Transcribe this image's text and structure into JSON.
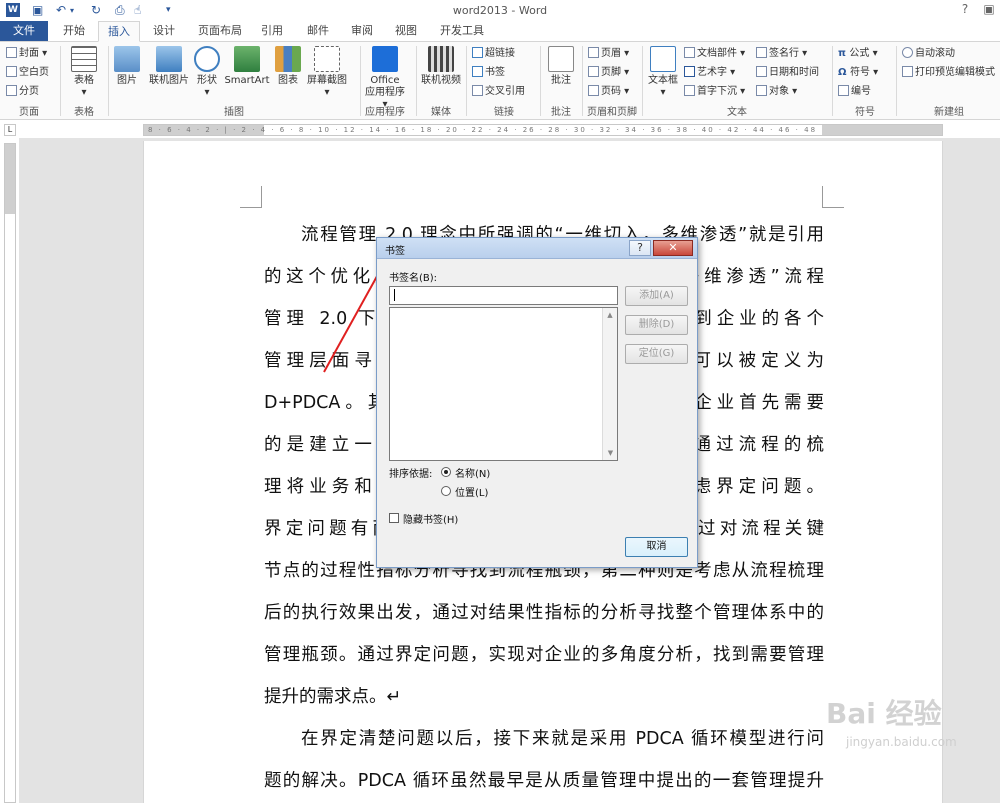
{
  "window": {
    "title": "word2013 - Word",
    "help": "?",
    "logo": "W"
  },
  "tabs": [
    "文件",
    "开始",
    "插入",
    "设计",
    "页面布局",
    "引用",
    "邮件",
    "审阅",
    "视图",
    "开发工具"
  ],
  "ribbon": {
    "page": {
      "cover": "封面",
      "blank": "空白页",
      "break": "分页",
      "group": "页面"
    },
    "table": {
      "label": "表格",
      "group": "表格"
    },
    "illus": {
      "picture": "图片",
      "online_picture": "联机图片",
      "shapes": "形状",
      "smartart": "SmartArt",
      "chart": "图表",
      "screenshot": "屏幕截图",
      "group": "插图"
    },
    "apps": {
      "label1": "Office",
      "label2": "应用程序",
      "group": "应用程序"
    },
    "media": {
      "label": "联机视频",
      "group": "媒体"
    },
    "links": {
      "hyperlink": "超链接",
      "bookmark": "书签",
      "xref": "交叉引用",
      "group": "链接"
    },
    "comments": {
      "label": "批注",
      "group": "批注"
    },
    "hf": {
      "header": "页眉",
      "footer": "页脚",
      "page_num": "页码",
      "group": "页眉和页脚"
    },
    "text": {
      "textbox": "文本框",
      "parts": "文档部件",
      "wordart": "艺术字",
      "dropcap": "首字下沉",
      "sigline": "签名行",
      "datetime": "日期和时间",
      "object": "对象",
      "group": "文本"
    },
    "symbols": {
      "equation": "公式",
      "symbol": "符号",
      "number": "编号",
      "group": "符号"
    },
    "newgroup": {
      "autoscroll": "自动滚动",
      "preview": "打印预览编辑模式",
      "group": "新建组"
    }
  },
  "document": {
    "lines": [
      "流程管理 2.0 理念中所强调的“一维切入，多维渗透”就是引用",
      "的这个优化方法。“一维切入”的是流程，“多维渗透”流程",
      "管理 2.0 下的流程管理以流程为切入，深入到企业的各个",
      "管理层面寻求优化与提升。流程管理的方法可以被定义为",
      "D+PDCA。其中 D 代表界定问题。也就是说企业首先需要",
      "的是建立一套流程体系，在流程体系之上，通过流程的梳",
      "理将业务和管理活动串联起来，之后开始考虑界定问题。",
      "界定问题有两种方式，一种是从流程出发，通过对流程关键",
      "节点的过程性指标分析寻找到流程瓶颈，第二种则是考虑从流程梳理",
      "后的执行效果出发，通过对结果性指标的分析寻找整个管理体系中的",
      "管理瓶颈。通过界定问题，实现对企业的多角度分析，找到需要管理",
      "提升的需求点。↵",
      "在界定清楚问题以后，接下来就是采用 PDCA 循环模型进行问",
      "题的解决。PDCA 循环虽然最早是从质量管理中提出的一套管理提升"
    ]
  },
  "dialog": {
    "title": "书签",
    "help": "?",
    "close": "✕",
    "name_label": "书签名(B):",
    "name_value": "",
    "add": "添加(A)",
    "delete": "删除(D)",
    "goto": "定位(G)",
    "sort_label": "排序依据:",
    "sort_name": "名称(N)",
    "sort_location": "位置(L)",
    "hidden": "隐藏书签(H)",
    "cancel": "取消",
    "sort_selected": "name"
  },
  "watermark": {
    "text": "Bai 经验",
    "sub": "jingyan.baidu.com"
  },
  "colors": {
    "accent": "#2b579a",
    "arrow": "#e02020"
  }
}
